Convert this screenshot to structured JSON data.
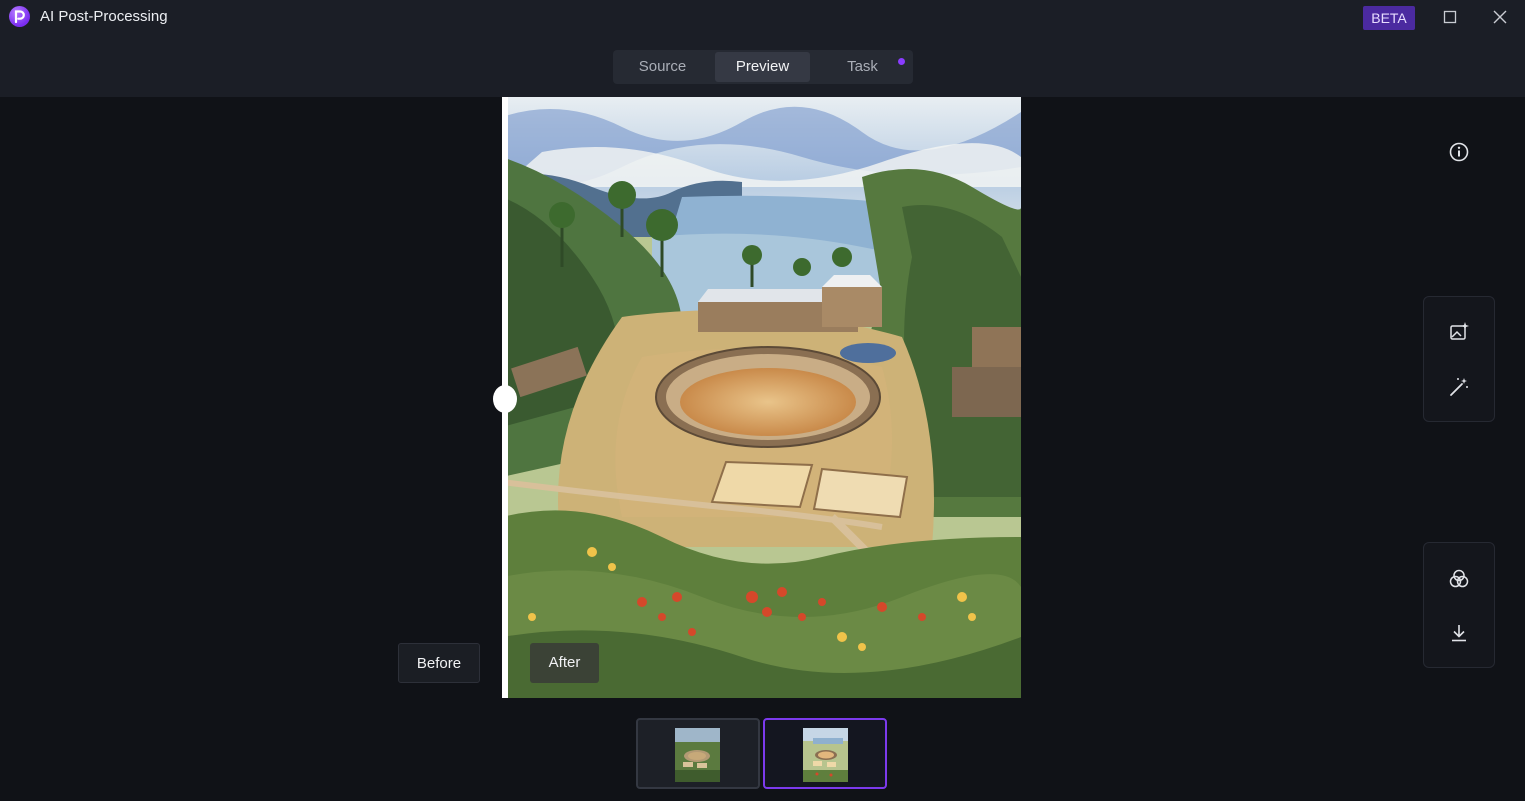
{
  "window": {
    "title": "AI Post-Processing",
    "badge": "BETA",
    "icons": [
      "app-logo-icon",
      "maximize-icon",
      "close-icon"
    ]
  },
  "tabs": [
    {
      "label": "Source",
      "active": false
    },
    {
      "label": "Preview",
      "active": true
    },
    {
      "label": "Task",
      "active": false,
      "notification": true
    }
  ],
  "preview": {
    "before_label": "Before",
    "after_label": "After",
    "compare_position": 0.01
  },
  "side_tools": {
    "info": "info-icon",
    "top_group": [
      "ai-image-enhance-icon",
      "magic-wand-icon"
    ],
    "bottom_group": [
      "color-blend-icon",
      "download-icon"
    ]
  },
  "thumbnails": [
    {
      "name": "photo-thumbnail",
      "selected": false
    },
    {
      "name": "watercolor-thumbnail",
      "selected": true
    }
  ],
  "colors": {
    "accent": "#7c3aed",
    "badge_bg": "#4b2aa0",
    "background": "#101217",
    "header": "#1b1e26"
  }
}
